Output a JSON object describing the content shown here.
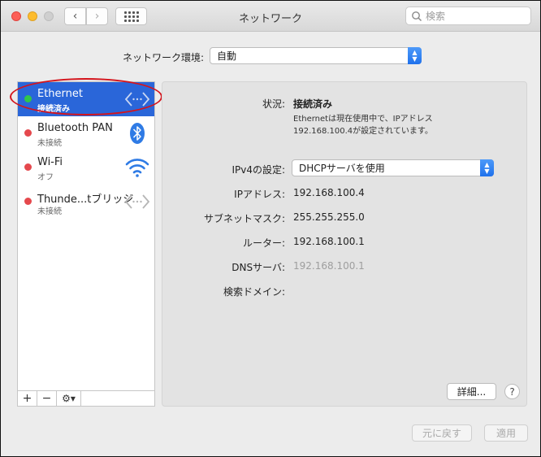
{
  "window": {
    "title": "ネットワーク"
  },
  "toolbar": {
    "back_label": "‹",
    "forward_label": "›"
  },
  "search": {
    "placeholder": "検索"
  },
  "location": {
    "label": "ネットワーク環境:",
    "value": "自動"
  },
  "sidebar": {
    "services": [
      {
        "name": "Ethernet",
        "status": "接続済み",
        "status_color": "#30c64a",
        "icon": "ethernet-icon",
        "selected": true
      },
      {
        "name": "Bluetooth PAN",
        "status": "未接続",
        "status_color": "#e5484d",
        "icon": "bluetooth-icon",
        "selected": false
      },
      {
        "name": "Wi-Fi",
        "status": "オフ",
        "status_color": "#e5484d",
        "icon": "wifi-icon",
        "selected": false
      },
      {
        "name": "Thunde...tブリッジ",
        "status": "未接続",
        "status_color": "#e5484d",
        "icon": "thunderbolt-bridge-icon",
        "selected": false
      }
    ],
    "tools": {
      "add": "+",
      "remove": "−",
      "gear": "⚙▾"
    }
  },
  "detail": {
    "status_label": "状況:",
    "status_value": "接続済み",
    "description_line1": "Ethernetは現在使用中で、IPアドレス",
    "description_line2": "192.168.100.4が設定されています。",
    "ipv4_label": "IPv4の設定:",
    "ipv4_value": "DHCPサーバを使用",
    "ip_label": "IPアドレス:",
    "ip_value": "192.168.100.4",
    "subnet_label": "サブネットマスク:",
    "subnet_value": "255.255.255.0",
    "router_label": "ルーター:",
    "router_value": "192.168.100.1",
    "dns_label": "DNSサーバ:",
    "dns_value": "192.168.100.1",
    "search_domain_label": "検索ドメイン:",
    "advanced_button": "詳細...",
    "help_button": "?"
  },
  "footer": {
    "revert_button": "元に戻す",
    "apply_button": "適用"
  },
  "colors": {
    "accent": "#2a66d9",
    "annotation": "#d4141c"
  }
}
